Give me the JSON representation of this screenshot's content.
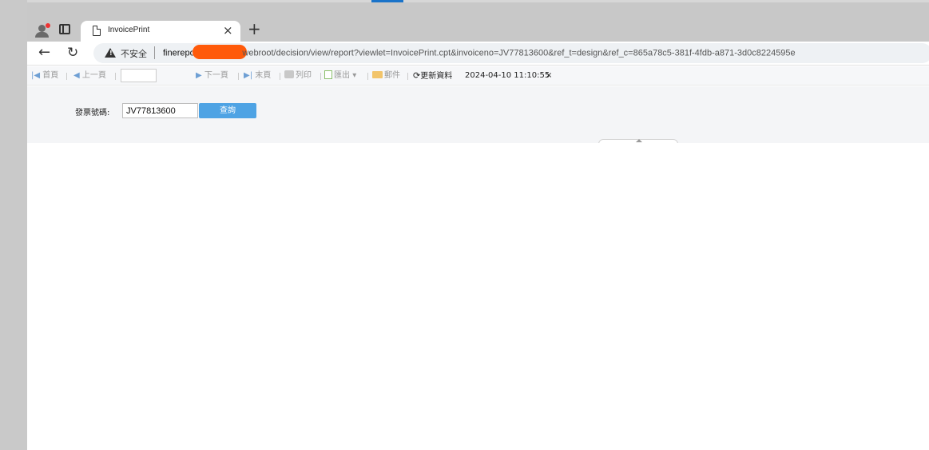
{
  "browser": {
    "tab_title": "InvoicePrint",
    "tab_close": "×",
    "new_tab": "+",
    "back": "←",
    "reload": "↻",
    "security_label": "不安全",
    "url_host_prefix": "finerepor",
    "url_rest": "webroot/decision/view/report?viewlet=InvoicePrint.cpt&invoiceno=JV77813600&ref_t=design&ref_c=865a78c5-381f-4fdb-a871-3d0c8224595e",
    "redaction_color": "#ff5a0a"
  },
  "toolbar": {
    "first_page": "首頁",
    "prev_page": "上一頁",
    "next_page": "下一頁",
    "last_page": "末頁",
    "print": "列印",
    "export": "匯出",
    "mail": "郵件",
    "refresh": "更新資料",
    "timestamp": "2024-04-10 11:10:55",
    "timestamp_close": "×"
  },
  "params": {
    "invoice_label": "發票號碼:",
    "invoice_value": "JV77813600",
    "query_button": "查詢"
  },
  "colors": {
    "accent": "#4ea3e4",
    "toolbar_icon": "#6e9fd4"
  }
}
